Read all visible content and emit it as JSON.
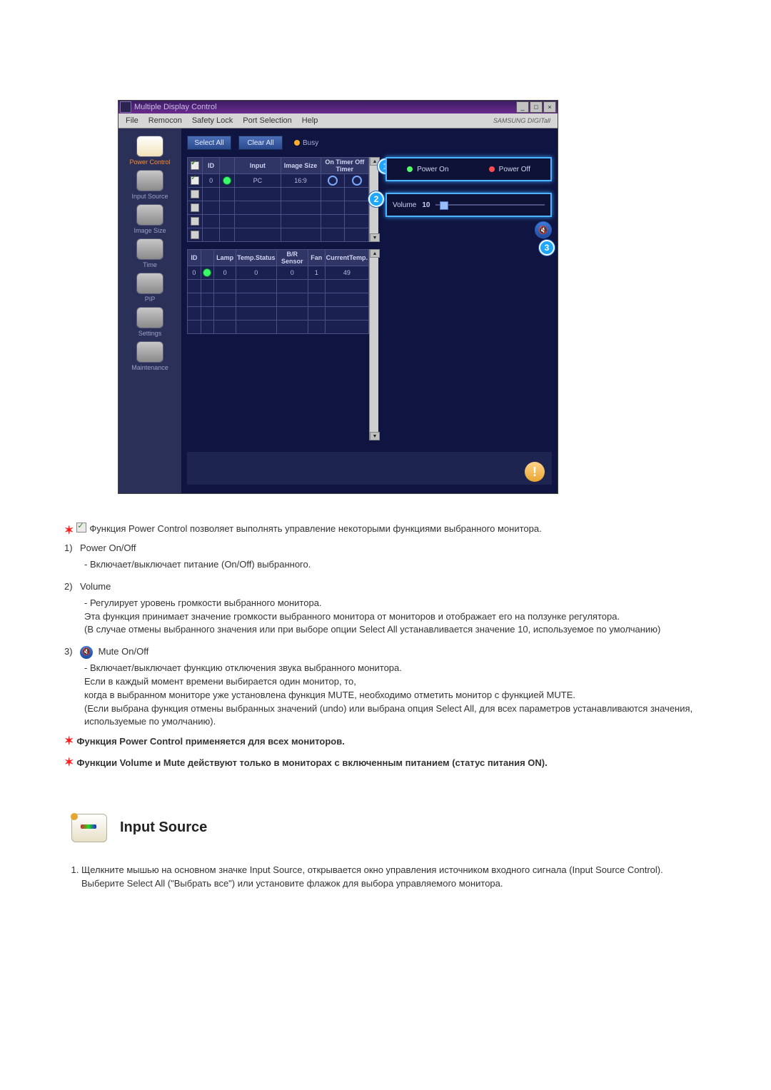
{
  "app": {
    "title": "Multiple Display Control",
    "brand": "SAMSUNG DIGITall",
    "menu": [
      "File",
      "Remocon",
      "Safety Lock",
      "Port Selection",
      "Help"
    ],
    "window_buttons": [
      "minimize",
      "maximize",
      "close"
    ]
  },
  "sidebar": [
    {
      "label": "Power Control",
      "selected": true
    },
    {
      "label": "Input Source",
      "selected": false
    },
    {
      "label": "Image Size",
      "selected": false
    },
    {
      "label": "Time",
      "selected": false
    },
    {
      "label": "PIP",
      "selected": false
    },
    {
      "label": "Settings",
      "selected": false
    },
    {
      "label": "Maintenance",
      "selected": false
    }
  ],
  "toolbar": {
    "select_all": "Select All",
    "clear_all": "Clear All",
    "busy_label": "Busy"
  },
  "upper_table": {
    "headers": [
      "",
      "ID",
      "",
      "Input",
      "Image Size",
      "On Timer Off Timer"
    ],
    "rows": [
      {
        "checked": true,
        "id": "0",
        "status": "green",
        "input": "PC",
        "image_size": "16:9",
        "timer1": "ring",
        "timer2": "ring"
      },
      {
        "checked": false
      },
      {
        "checked": false
      },
      {
        "checked": false
      },
      {
        "checked": false
      }
    ]
  },
  "lower_table": {
    "headers": [
      "ID",
      "",
      "Lamp",
      "Temp.Status",
      "B/R Sensor",
      "Fan",
      "CurrentTemp."
    ],
    "rows": [
      {
        "id": "0",
        "status": "green",
        "lamp": "0",
        "temp_status": "0",
        "br_sensor": "0",
        "fan": "1",
        "current_temp": "49"
      },
      {},
      {},
      {},
      {}
    ]
  },
  "right": {
    "power_on": "Power On",
    "power_off": "Power Off",
    "volume_label": "Volume",
    "volume_value": "10"
  },
  "callouts": {
    "c1": "1",
    "c2": "2",
    "c3": "3"
  },
  "doc": {
    "intro": "Функция Power Control позволяет выполнять управление некоторыми функциями выбранного монитора.",
    "item1_title": "Power On/Off",
    "item1_sub": "- Включает/выключает питание (On/Off) выбранного.",
    "item2_title": "Volume",
    "item2_sub1": "- Регулирует уровень громкости выбранного монитора.",
    "item2_sub2": "Эта функция принимает значение громкости выбранного монитора от мониторов и отображает его на ползунке регулятора.",
    "item2_sub3": "(В случае отмены выбранного значения или при выборе опции Select All устанавливается значение 10, используемое по умолчанию)",
    "item3_title": "Mute On/Off",
    "item3_sub1": "- Включает/выключает функцию отключения звука выбранного монитора.",
    "item3_sub2": "Если в каждый момент времени выбирается один монитор, то,",
    "item3_sub3": "когда в выбранном мониторе уже установлена функция MUTE, необходимо отметить монитор с функцией MUTE.",
    "item3_sub4": "(Если выбрана функция отмены выбранных значений (undo) или выбрана опция Select All, для всех параметров устанавливаются значения, используемые по умолчанию).",
    "note1": "Функция Power Control применяется для всех мониторов.",
    "note2": "Функции Volume и Mute действуют только в мониторах с включенным питанием (статус питания ON).",
    "input_source_heading": "Input Source",
    "input_source_p1": "Щелкните мышью на основном значке Input Source, открывается окно управления источником входного сигнала (Input Source Control).",
    "input_source_p2": "Выберите Select All (\"Выбрать все\") или установите флажок для выбора управляемого монитора."
  }
}
